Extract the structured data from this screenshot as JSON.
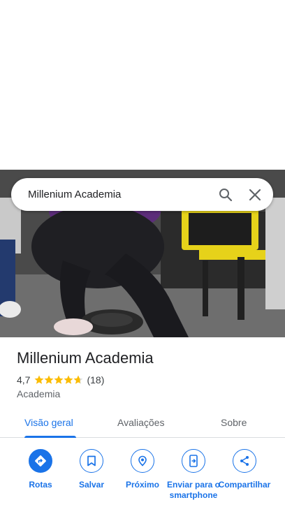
{
  "search": {
    "query": "Millenium Academia"
  },
  "place": {
    "name": "Millenium Academia",
    "rating": "4,7",
    "rating_value": 4.7,
    "review_count": "(18)",
    "category": "Academia"
  },
  "tabs": [
    {
      "label": "Visão geral",
      "active": true
    },
    {
      "label": "Avaliações",
      "active": false
    },
    {
      "label": "Sobre",
      "active": false
    }
  ],
  "actions": [
    {
      "label": "Rotas",
      "icon": "directions-icon"
    },
    {
      "label": "Salvar",
      "icon": "bookmark-icon"
    },
    {
      "label": "Próximo",
      "icon": "nearby-icon"
    },
    {
      "label": "Enviar para o smartphone",
      "icon": "send-to-phone-icon"
    },
    {
      "label": "Compartilhar",
      "icon": "share-icon"
    }
  ],
  "colors": {
    "accent": "#1a73e8",
    "star": "#fbbc04"
  }
}
